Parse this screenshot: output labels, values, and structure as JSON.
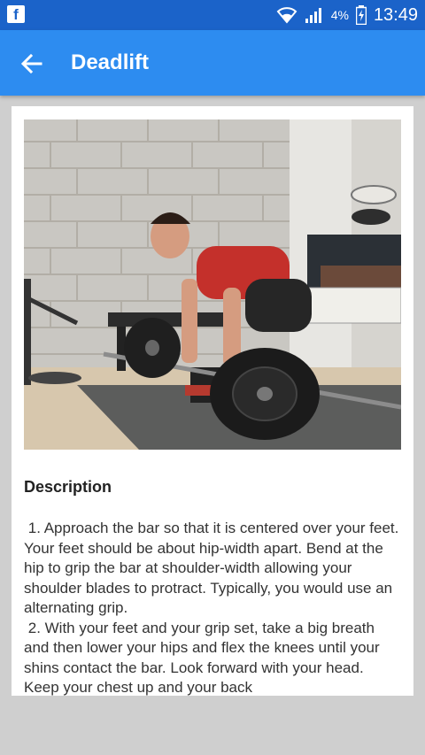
{
  "status_bar": {
    "app_icon": "facebook-icon",
    "app_icon_glyph": "f",
    "battery_percent": "4%",
    "time": "13:49"
  },
  "app_bar": {
    "title": "Deadlift",
    "back_icon": "arrow-left-icon"
  },
  "card": {
    "image_alt": "Person performing a deadlift with a loaded barbell",
    "description_heading": "Description",
    "description_text": " 1. Approach the bar so that it is centered over your feet. Your feet should be about hip-width apart. Bend at the hip to grip the bar at shoulder-width allowing your shoulder blades to protract. Typically, you would use an alternating grip.\n 2. With your feet and your grip set, take a big breath and then lower your hips and flex the knees until your shins contact the bar. Look forward with your head. Keep your chest up and your back"
  },
  "colors": {
    "status_bar": "#1b63c9",
    "app_bar": "#2d8cf0",
    "background": "#cfcfcf"
  }
}
